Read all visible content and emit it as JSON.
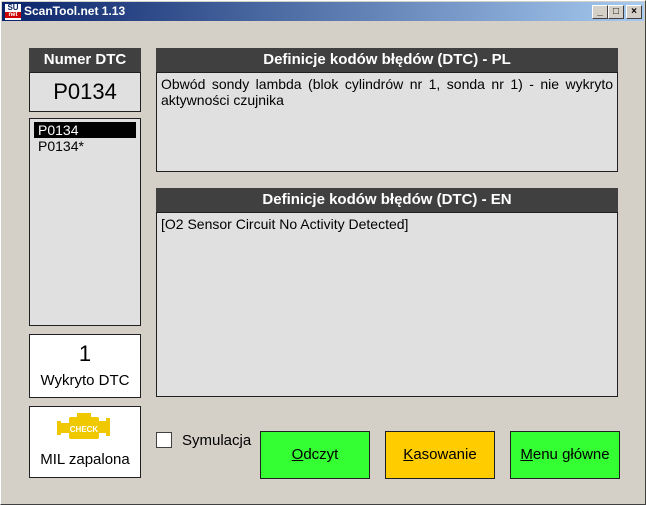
{
  "window": {
    "title": "ScanTool.net 1.13",
    "icon_top": "SU",
    "icon_bottom": "net",
    "minimize_glyph": "_",
    "maximize_glyph": "□",
    "close_glyph": "×"
  },
  "sidebar": {
    "dtc_label": "Numer DTC",
    "current_code": "P0134",
    "codes": [
      "P0134",
      "P0134*"
    ],
    "count": "1",
    "count_label": "Wykryto DTC",
    "mil_icon_text": "CHECK",
    "mil_label": "MIL zapalona"
  },
  "panels": {
    "pl_header": "Definicje kodów błędów (DTC) - PL",
    "pl_text": "Obwód sondy lambda (blok cylindrów nr 1, sonda nr 1) - nie wykryto aktywności czujnika",
    "en_header": "Definicje kodów błędów (DTC) - EN",
    "en_text": "[O2 Sensor Circuit No Activity Detected]"
  },
  "controls": {
    "simulation_label": "Symulacja",
    "read_key": "O",
    "read_rest": "dczyt",
    "clear_key": "K",
    "clear_rest": "asowanie",
    "menu_key": "M",
    "menu_rest": "enu główne"
  },
  "colors": {
    "read_button": "#33ff33",
    "clear_button": "#ffcc00",
    "menu_button": "#33ff33",
    "check_engine": "#f0c800"
  }
}
